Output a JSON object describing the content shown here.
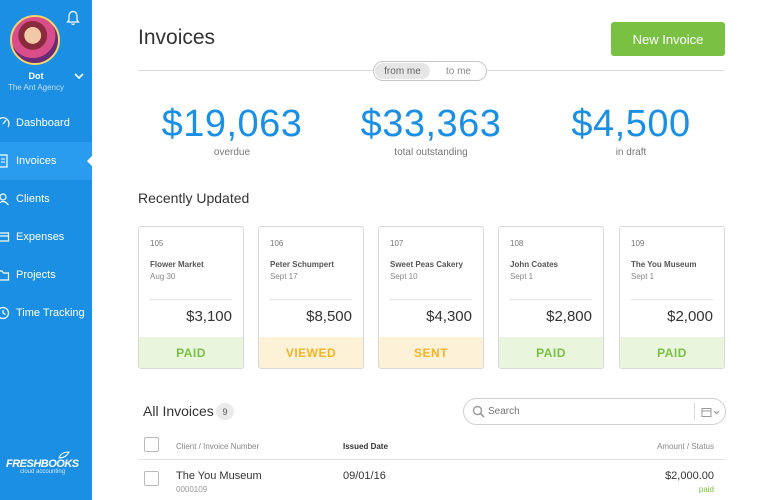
{
  "user": {
    "name": "Dot",
    "org": "The Ant Agency"
  },
  "nav": [
    {
      "label": "Dashboard",
      "icon": "dashboard-icon"
    },
    {
      "label": "Invoices",
      "icon": "invoice-icon",
      "active": true
    },
    {
      "label": "Clients",
      "icon": "clients-icon"
    },
    {
      "label": "Expenses",
      "icon": "expenses-icon"
    },
    {
      "label": "Projects",
      "icon": "projects-icon"
    },
    {
      "label": "Time Tracking",
      "icon": "clock-icon"
    }
  ],
  "brand": {
    "name": "FRESHBOOKS",
    "sub": "cloud accounting"
  },
  "header": {
    "title": "Invoices",
    "new_invoice_label": "New Invoice",
    "toggle": {
      "from_me": "from me",
      "to_me": "to me"
    }
  },
  "stats": [
    {
      "value": "$19,063",
      "label": "overdue"
    },
    {
      "value": "$33,363",
      "label": "total outstanding"
    },
    {
      "value": "$4,500",
      "label": "in draft"
    }
  ],
  "recent": {
    "title": "Recently Updated",
    "cards": [
      {
        "number": "105",
        "client": "Flower Market",
        "date": "Aug 30",
        "amount": "$3,100",
        "status": "PAID"
      },
      {
        "number": "106",
        "client": "Peter Schumpert",
        "date": "Sept 17",
        "amount": "$8,500",
        "status": "VIEWED"
      },
      {
        "number": "107",
        "client": "Sweet Peas Cakery",
        "date": "Sept 10",
        "amount": "$4,300",
        "status": "SENT"
      },
      {
        "number": "108",
        "client": "John Coates",
        "date": "Sept 1",
        "amount": "$2,800",
        "status": "PAID"
      },
      {
        "number": "109",
        "client": "The You Museum",
        "date": "Sept 1",
        "amount": "$2,000",
        "status": "PAID"
      }
    ]
  },
  "all_invoices": {
    "title": "All Invoices",
    "count": "9",
    "search_placeholder": "Search",
    "columns": {
      "client": "Client / Invoice Number",
      "date": "Issued Date",
      "amount": "Amount / Status"
    },
    "rows": [
      {
        "client": "The You Museum",
        "number": "0000109",
        "date": "09/01/16",
        "amount": "$2,000.00",
        "status": "paid"
      }
    ]
  },
  "colors": {
    "sidebar": "#1a8fe3",
    "accent": "#1a8fe3",
    "success": "#7ac143",
    "warning": "#f0b429"
  }
}
